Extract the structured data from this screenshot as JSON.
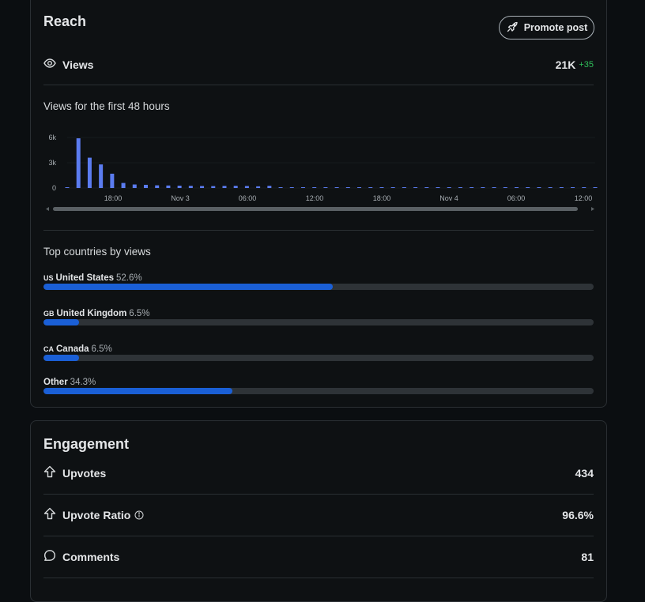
{
  "reach": {
    "title": "Reach",
    "promote_label": "Promote post",
    "views_label": "Views",
    "views_value": "21K",
    "views_delta": "+35",
    "chart_title": "Views for the first 48 hours",
    "countries_title": "Top countries by views",
    "countries": [
      {
        "code": "US",
        "name": "United States",
        "pct_label": "52.6%",
        "pct": 52.6
      },
      {
        "code": "GB",
        "name": "United Kingdom",
        "pct_label": "6.5%",
        "pct": 6.5
      },
      {
        "code": "CA",
        "name": "Canada",
        "pct_label": "6.5%",
        "pct": 6.5
      },
      {
        "code": "",
        "name": "Other",
        "pct_label": "34.3%",
        "pct": 34.3
      }
    ]
  },
  "engagement": {
    "title": "Engagement",
    "rows": [
      {
        "label": "Upvotes",
        "value": "434",
        "icon": "upvote-icon"
      },
      {
        "label": "Upvote Ratio",
        "value": "96.6%",
        "icon": "upvote-icon",
        "info": true
      },
      {
        "label": "Comments",
        "value": "81",
        "icon": "comment-icon"
      }
    ]
  },
  "colors": {
    "bar": "#5b7cf0",
    "progress": "#1a5fd6",
    "delta": "#2fbf5a"
  },
  "chart_data": {
    "type": "bar",
    "title": "Views for the first 48 hours",
    "y_ticks": [
      "6k",
      "3k",
      "0"
    ],
    "ylim": [
      0,
      6000
    ],
    "x_tick_labels": [
      "18:00",
      "Nov 3",
      "06:00",
      "12:00",
      "18:00",
      "Nov 4",
      "06:00",
      "12:00"
    ],
    "values": [
      80,
      5900,
      3600,
      2800,
      1700,
      600,
      420,
      380,
      320,
      300,
      280,
      260,
      240,
      230,
      250,
      260,
      240,
      200,
      260,
      80,
      70,
      60,
      60,
      60,
      60,
      60,
      60,
      60,
      60,
      60,
      60,
      60,
      60,
      60,
      60,
      60,
      60,
      60,
      60,
      60,
      60,
      60,
      60,
      60,
      60,
      60,
      60,
      60
    ]
  }
}
